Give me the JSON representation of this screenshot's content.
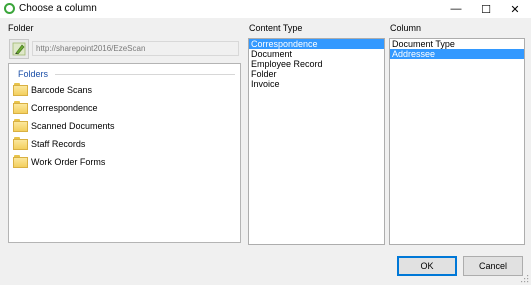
{
  "window": {
    "title": "Choose a column",
    "minimize_glyph": "—",
    "maximize_glyph": "☐",
    "close_glyph": "✕"
  },
  "folder_panel": {
    "label": "Folder",
    "path_value": "http://sharepoint2016/EzeScan",
    "folders_group_label": "Folders",
    "folders": [
      {
        "label": "Barcode Scans"
      },
      {
        "label": "Correspondence"
      },
      {
        "label": "Scanned Documents"
      },
      {
        "label": "Staff Records"
      },
      {
        "label": "Work Order Forms"
      }
    ]
  },
  "content_type_panel": {
    "label": "Content Type",
    "items": [
      {
        "label": "Correspondence",
        "selected": true
      },
      {
        "label": "Document",
        "selected": false
      },
      {
        "label": "Employee Record",
        "selected": false
      },
      {
        "label": "Folder",
        "selected": false
      },
      {
        "label": "Invoice",
        "selected": false
      }
    ]
  },
  "column_panel": {
    "label": "Column",
    "items": [
      {
        "label": "Document Type",
        "selected": false
      },
      {
        "label": "Addressee",
        "selected": true
      }
    ]
  },
  "buttons": {
    "ok_label": "OK",
    "cancel_label": "Cancel"
  },
  "colors": {
    "selection": "#3399ff",
    "group_label": "#1a4ea8",
    "app_icon": "#3aa53a",
    "default_button_border": "#0078d7"
  }
}
